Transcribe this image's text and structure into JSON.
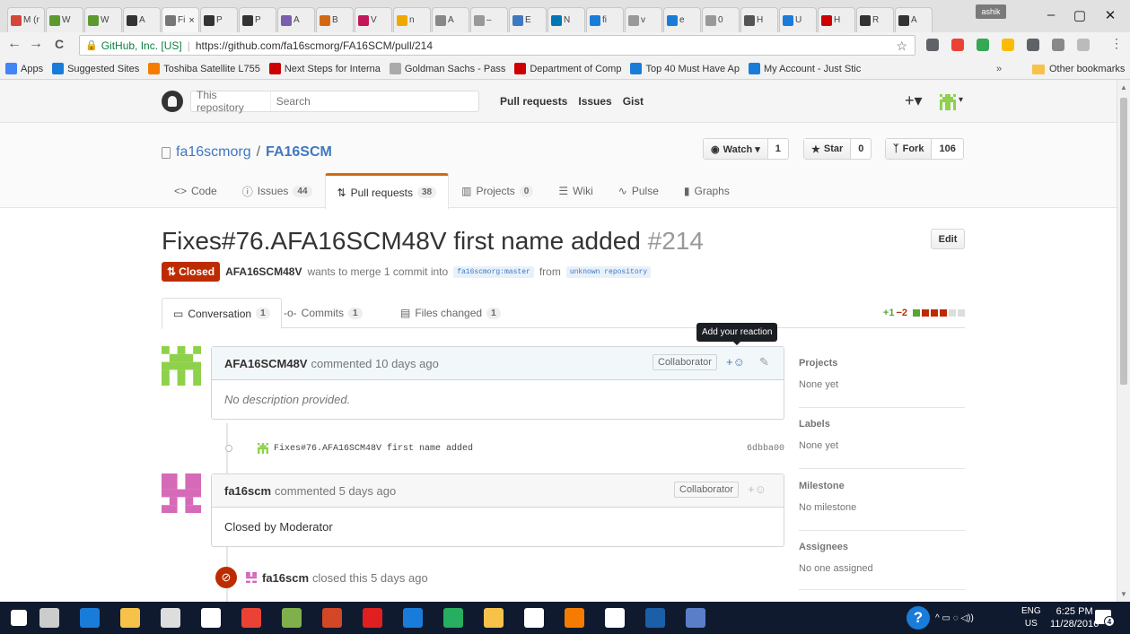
{
  "browser": {
    "tabs": [
      {
        "label": "M (r",
        "color": "#d44638"
      },
      {
        "label": "W",
        "color": "#5c9a2f"
      },
      {
        "label": "W",
        "color": "#5c9a2f"
      },
      {
        "label": "A",
        "color": "#333333"
      },
      {
        "label": "Fi",
        "color": "#777777"
      },
      {
        "label": "P",
        "color": "#333333"
      },
      {
        "label": "P",
        "color": "#333333"
      },
      {
        "label": "A",
        "color": "#7a5fb0"
      },
      {
        "label": "B",
        "color": "#d26911"
      },
      {
        "label": "V",
        "color": "#c2185b"
      },
      {
        "label": "n",
        "color": "#f0a800"
      },
      {
        "label": "A",
        "color": "#888888"
      },
      {
        "label": "–",
        "color": "#999999"
      },
      {
        "label": "E",
        "color": "#4078c0"
      },
      {
        "label": "N",
        "color": "#0077b5"
      },
      {
        "label": "fi",
        "color": "#1a7cd9"
      },
      {
        "label": "v",
        "color": "#999999"
      },
      {
        "label": "e",
        "color": "#1a7cd9"
      },
      {
        "label": "0",
        "color": "#999999"
      },
      {
        "label": "H",
        "color": "#555555"
      },
      {
        "label": "U",
        "color": "#1a7cd9"
      },
      {
        "label": "H",
        "color": "#cc0000"
      },
      {
        "label": "R",
        "color": "#333333"
      },
      {
        "label": "A",
        "color": "#333333"
      }
    ],
    "active_tab_close": "×",
    "profile": "ashik",
    "window_controls": {
      "minimize": "–",
      "maximize": "▢",
      "close": "✕"
    },
    "nav": {
      "back": "←",
      "forward": "→",
      "reload": "C"
    },
    "address": {
      "origin": "GitHub, Inc. [US]",
      "separator": "|",
      "url": "https://github.com/fa16scmorg/FA16SCM/pull/214",
      "star": "☆"
    },
    "extensions": [
      "#5f6368",
      "#ea4335",
      "#34a853",
      "#fbbc05",
      "#5f6368",
      "#888888",
      "#bbbbbb"
    ],
    "menu": "⋮",
    "bookmarks": [
      {
        "label": "Apps",
        "color": "#4285f4"
      },
      {
        "label": "Suggested Sites",
        "color": "#1a7cd9"
      },
      {
        "label": "Toshiba Satellite L755",
        "color": "#f57c00"
      },
      {
        "label": "Next Steps for Interna",
        "color": "#cc0000"
      },
      {
        "label": "Goldman Sachs - Pass",
        "color": "#aaaaaa"
      },
      {
        "label": "Department of Comp",
        "color": "#cc0000"
      },
      {
        "label": "Top 40 Must Have Ap",
        "color": "#1a7cd9"
      },
      {
        "label": "My Account - Just Stic",
        "color": "#1a7cd9"
      }
    ],
    "bookmarks_more": "»",
    "other_bookmarks": "Other bookmarks"
  },
  "gh": {
    "search_scope": "This repository",
    "search_placeholder": "Search",
    "nav": [
      "Pull requests",
      "Issues",
      "Gist"
    ],
    "plus": "+▾",
    "avatar_caret": "▾"
  },
  "repo": {
    "owner": "fa16scmorg",
    "slash": "/",
    "name": "FA16SCM",
    "watch": {
      "label": "Watch ▾",
      "count": "1",
      "icon": "eye-icon"
    },
    "star": {
      "label": "Star",
      "count": "0",
      "icon": "star-icon"
    },
    "fork": {
      "label": "Fork",
      "count": "106",
      "icon": "fork-icon"
    },
    "tabs": [
      {
        "label": "Code",
        "icon": "<>",
        "count": ""
      },
      {
        "label": "Issues",
        "icon": "ⓘ",
        "count": "44"
      },
      {
        "label": "Pull requests",
        "icon": "⇅",
        "count": "38"
      },
      {
        "label": "Projects",
        "icon": "▥",
        "count": "0"
      },
      {
        "label": "Wiki",
        "icon": "☰",
        "count": ""
      },
      {
        "label": "Pulse",
        "icon": "∿",
        "count": ""
      },
      {
        "label": "Graphs",
        "icon": "▮",
        "count": ""
      }
    ]
  },
  "pr": {
    "title": "Fixes#76.AFA16SCM48V first name added",
    "number": "#214",
    "edit": "Edit",
    "state": "Closed",
    "state_icon": "⇅",
    "author": "AFA16SCM48V",
    "meta_text": "wants to merge 1 commit into",
    "base_branch": "fa16scmorg:master",
    "from_text": "from",
    "head_branch": "unknown repository",
    "tabs": [
      {
        "label": "Conversation",
        "icon": "▭",
        "count": "1"
      },
      {
        "label": "Commits",
        "icon": "-o-",
        "count": "1"
      },
      {
        "label": "Files changed",
        "icon": "▤",
        "count": "1"
      }
    ],
    "diffstat": {
      "add": "+1",
      "del": "−2",
      "blocks": [
        "#55a532",
        "#bd2c00",
        "#bd2c00",
        "#bd2c00",
        "#dddddd",
        "#dddddd"
      ]
    }
  },
  "timeline": {
    "tooltip": "Add your reaction",
    "comment1": {
      "author": "AFA16SCM48V",
      "meta": "commented 10 days ago",
      "badge": "Collaborator",
      "reaction": "+☺",
      "pencil": "✎",
      "body": "No description provided."
    },
    "commit": {
      "message": "Fixes#76.AFA16SCM48V first name added",
      "sha": "6dbba00"
    },
    "comment2": {
      "author": "fa16scm",
      "meta": "commented 5 days ago",
      "badge": "Collaborator",
      "reaction": "+☺",
      "body": "Closed by Moderator"
    },
    "event": {
      "icon": "⊘",
      "actor": "fa16scm",
      "text": "closed this 5 days ago"
    }
  },
  "sidebar": [
    {
      "heading": "Projects",
      "value": "None yet"
    },
    {
      "heading": "Labels",
      "value": "None yet"
    },
    {
      "heading": "Milestone",
      "value": "No milestone"
    },
    {
      "heading": "Assignees",
      "value": "No one assigned"
    }
  ],
  "taskbar": {
    "apps": [
      "#ffffff",
      "#cccccc",
      "#1a7cd9",
      "#f6c24a",
      "#dddddd",
      "#ffffff",
      "#ea4335",
      "#7fb04b",
      "#d24726",
      "#e02020",
      "#1a7cd9",
      "#27ae60",
      "#f6c24a",
      "#ffffff",
      "#f57c00",
      "#ffffff",
      "#1a5fa8",
      "#5b7ec9"
    ],
    "help": "?",
    "tray": "^ ▭ ◌ ◁))",
    "lang_top": "ENG",
    "lang_bottom": "US",
    "time": "6:25 PM",
    "date": "11/28/2016",
    "notifications": "4"
  }
}
